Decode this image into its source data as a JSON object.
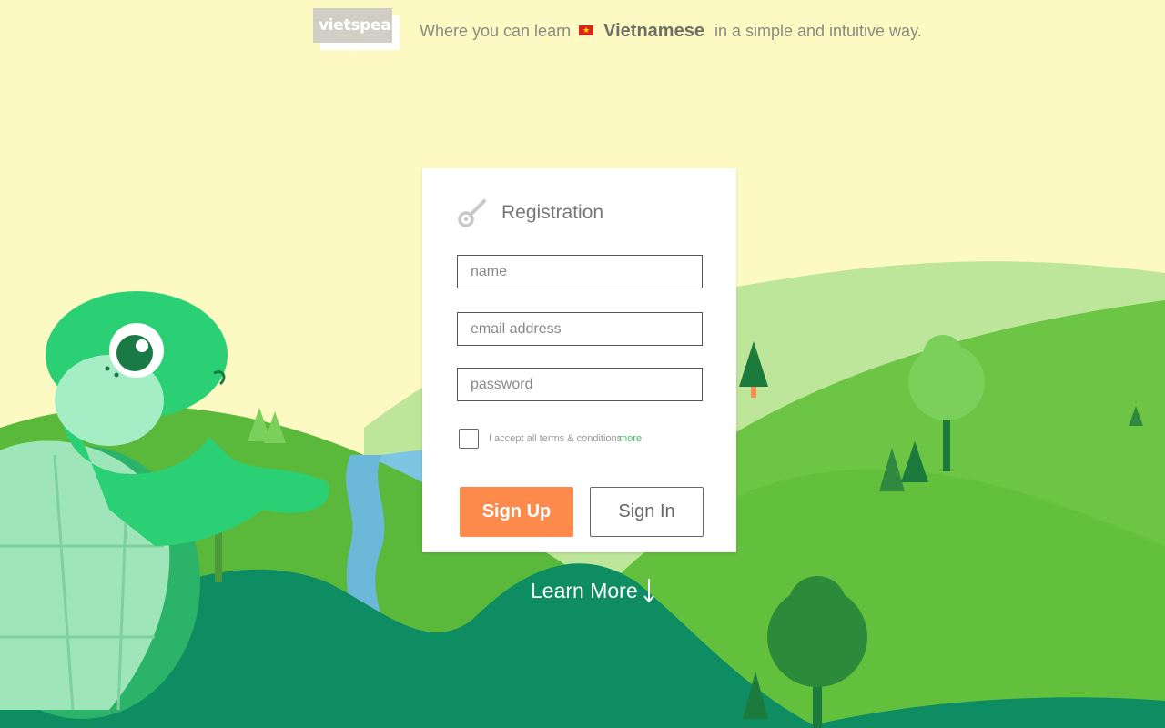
{
  "header": {
    "logo_text": "vietspeak",
    "tagline_before": "Where you can learn",
    "language": "Vietnamese",
    "tagline_after": "in a simple and intuitive way.",
    "flag_star": "★"
  },
  "registration": {
    "title": "Registration",
    "name_placeholder": "name",
    "email_placeholder": "email address",
    "password_placeholder": "password",
    "terms_text": "I accept all terms & conditions",
    "terms_more": "more",
    "signup_label": "Sign Up",
    "signin_label": "Sign In"
  },
  "learn_more": "Learn More",
  "colors": {
    "background": "#fcf9c2",
    "accent_orange": "#fe8a4c",
    "hill_green": "#5fbd3f",
    "dark_green": "#0e8c62",
    "link_green": "#4dbd72",
    "flag_red": "#da251d"
  },
  "icons": [
    "key-icon",
    "down-arrow-icon",
    "flag-icon"
  ]
}
